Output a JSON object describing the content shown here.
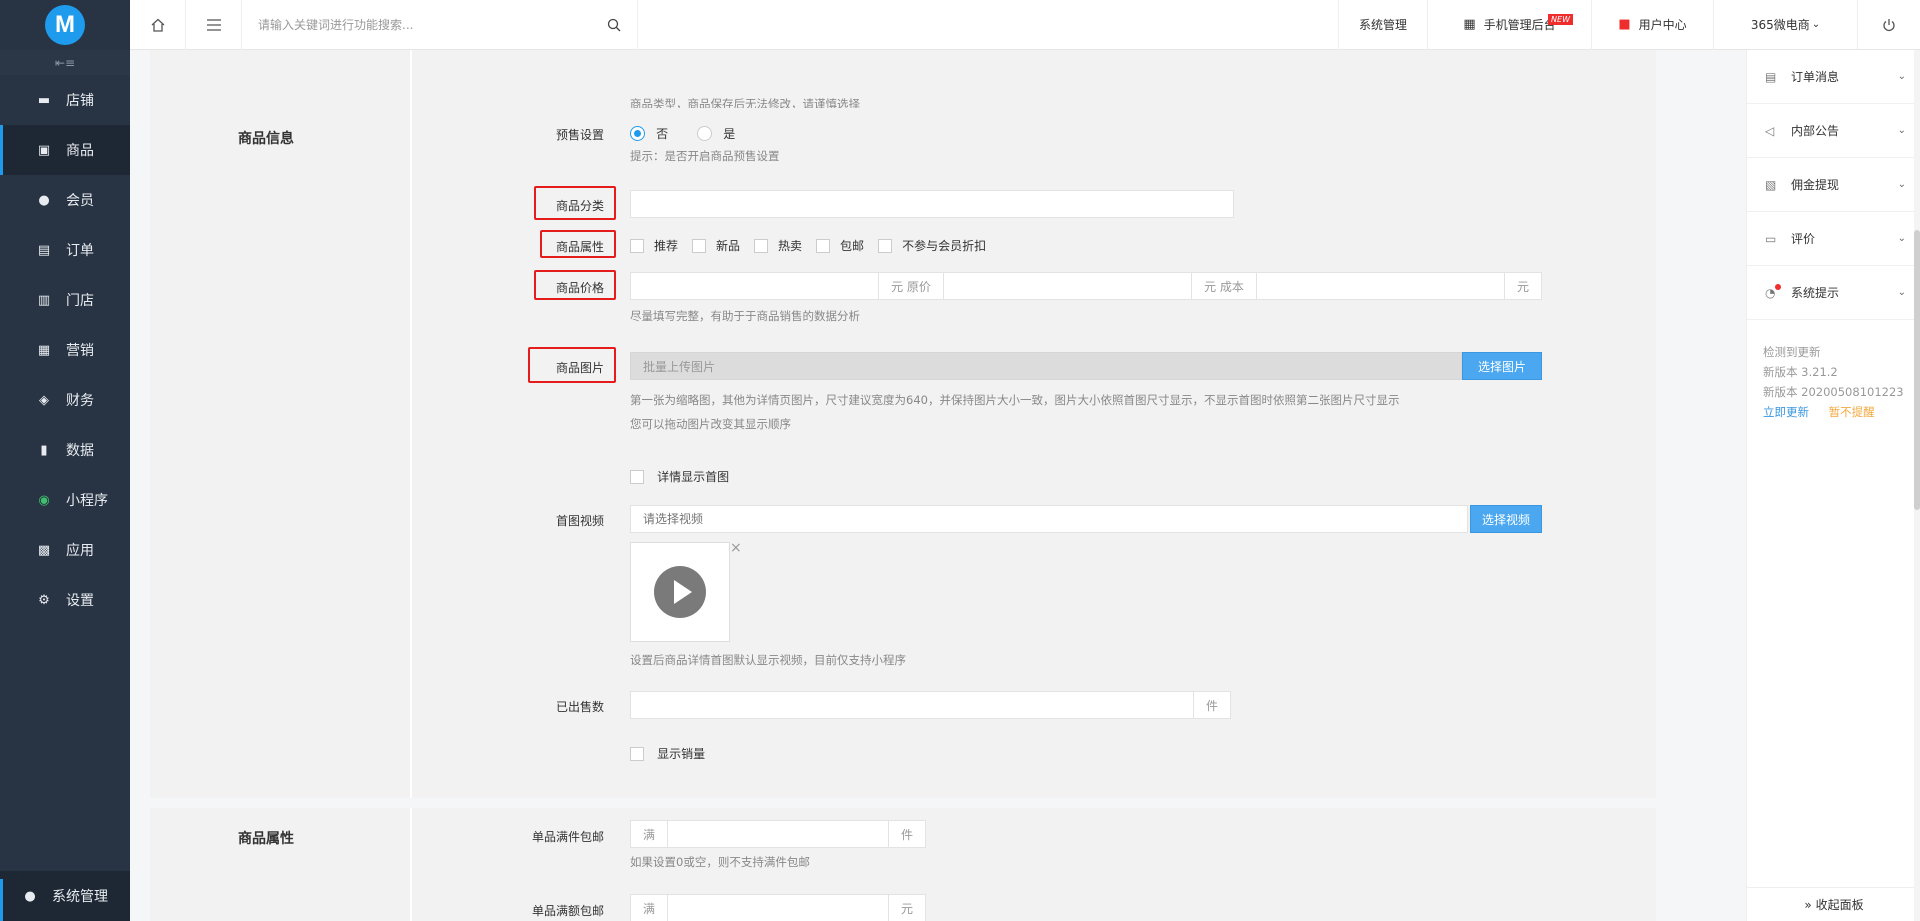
{
  "header": {
    "search_placeholder": "请输入关键词进行功能搜索...",
    "system_management": "系统管理",
    "mobile_backend": "手机管理后台",
    "new_badge": "NEW",
    "user_center": "用户中心",
    "shop_name": "365微电商",
    "shop_chevron": "⌄"
  },
  "sidebar": {
    "logo_text": "M",
    "items": [
      {
        "label": "店铺",
        "icon": "shop-icon",
        "glyph": "▬"
      },
      {
        "label": "商品",
        "icon": "goods-icon",
        "glyph": "▣"
      },
      {
        "label": "会员",
        "icon": "member-icon",
        "glyph": "●"
      },
      {
        "label": "订单",
        "icon": "order-icon",
        "glyph": "▤"
      },
      {
        "label": "门店",
        "icon": "store-icon",
        "glyph": "▥"
      },
      {
        "label": "营销",
        "icon": "gift-icon",
        "glyph": "▦"
      },
      {
        "label": "财务",
        "icon": "money-bag-icon",
        "glyph": "◈"
      },
      {
        "label": "数据",
        "icon": "chart-icon",
        "glyph": "▮"
      },
      {
        "label": "小程序",
        "icon": "mini-program-icon",
        "glyph": "◉"
      },
      {
        "label": "应用",
        "icon": "apps-icon",
        "glyph": "▩"
      },
      {
        "label": "设置",
        "icon": "gear-icon",
        "glyph": "⚙"
      }
    ],
    "bottom_label": "系统管理"
  },
  "top_section": {
    "hint": "商品类型，商品保存后无法修改，请谨慎选择"
  },
  "goods_info": {
    "section_title": "商品信息",
    "presale": {
      "label": "预售设置",
      "option_no": "否",
      "option_yes": "是",
      "selected": "否",
      "hint": "提示：是否开启商品预售设置"
    },
    "category": {
      "label": "商品分类",
      "value": ""
    },
    "attributes": {
      "label": "商品属性",
      "options": [
        "推荐",
        "新品",
        "热卖",
        "包邮",
        "不参与会员折扣"
      ]
    },
    "price": {
      "label": "商品价格",
      "unit_original": "元 原价",
      "unit_cost": "元 成本",
      "unit_yuan": "元",
      "hint": "尽量填写完整，有助于于商品销售的数据分析"
    },
    "images": {
      "label": "商品图片",
      "upload_placeholder": "批量上传图片",
      "button": "选择图片",
      "hint1": "第一张为缩略图，其他为详情页图片，尺寸建议宽度为640，并保持图片大小一致，图片大小依照首图尺寸显示，不显示首图时依照第二张图片尺寸显示",
      "hint2": "您可以拖动图片改变其显示顺序",
      "detail_show_first": "详情显示首图"
    },
    "video": {
      "label": "首图视频",
      "placeholder": "请选择视频",
      "button": "选择视频",
      "remove": "×",
      "hint": "设置后商品详情首图默认显示视频，目前仅支持小程序"
    },
    "sold": {
      "label": "已出售数",
      "unit": "件",
      "show_sales": "显示销量"
    }
  },
  "goods_attr": {
    "section_title": "商品属性",
    "free_ship_qty": {
      "label": "单品满件包邮",
      "prefix": "满",
      "unit": "件",
      "hint": "如果设置0或空，则不支持满件包邮"
    },
    "free_ship_amount": {
      "label": "单品满额包邮",
      "prefix": "满",
      "unit": "元"
    }
  },
  "right_panel": {
    "tabs": [
      {
        "label": "订单消息",
        "icon": "clipboard-icon",
        "glyph": "▤"
      },
      {
        "label": "内部公告",
        "icon": "speaker-icon",
        "glyph": "◁"
      },
      {
        "label": "佣金提现",
        "icon": "withdraw-icon",
        "glyph": "▧"
      },
      {
        "label": "评价",
        "icon": "comment-icon",
        "glyph": "▭"
      },
      {
        "label": "系统提示",
        "icon": "bell-icon",
        "glyph": "◔"
      }
    ],
    "update": {
      "line1": "检测到更新",
      "line2": "新版本 3.21.2",
      "line3": "新版本 20200508101223",
      "update_now": "立即更新",
      "remind_later": "暂不提醒"
    },
    "collapse": "» 收起面板"
  },
  "colors": {
    "sidebar_bg": "#283443",
    "accent": "#1f9bee",
    "highlight_border": "#e51c1c"
  }
}
